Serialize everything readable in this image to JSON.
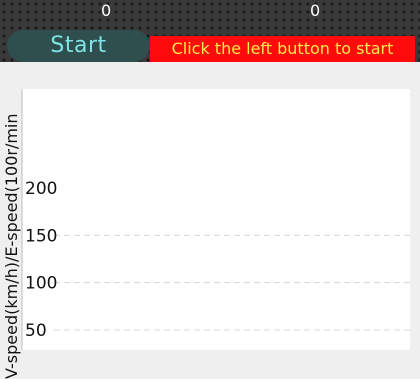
{
  "header": {
    "counter_left": "0",
    "counter_right": "0",
    "start_label": "Start",
    "status_message": "Click the left button to start"
  },
  "chart_data": {
    "type": "line",
    "title": "",
    "xlabel": "",
    "ylabel": "V-speed(km/h)/E-speed(100r/min",
    "ylim": [
      40,
      215
    ],
    "yticks": [
      50,
      100,
      150,
      200
    ],
    "grid": true,
    "series": []
  }
}
